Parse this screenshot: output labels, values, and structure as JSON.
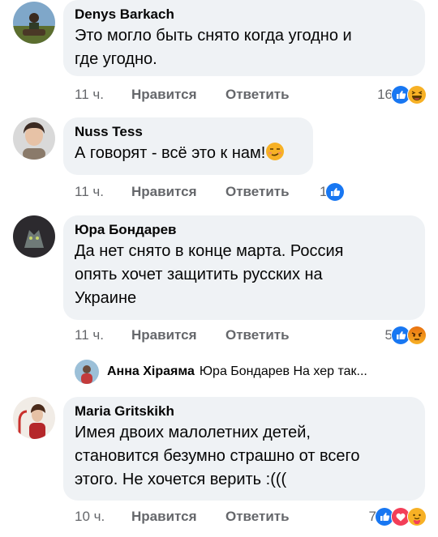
{
  "comments": [
    {
      "author": "Denys Barkach",
      "lines": [
        "Это могло быть снято когда угодно и",
        "где угодно."
      ],
      "time": "11 ч.",
      "like_label": "Нравится",
      "reply_label": "Ответить",
      "reaction_count": "16",
      "reactions": [
        "like-icon",
        "haha-icon"
      ]
    },
    {
      "author": "Nuss Tess",
      "lines": [
        "А говорят - всё это к нам!"
      ],
      "time": "11 ч.",
      "like_label": "Нравится",
      "reply_label": "Ответить",
      "reaction_count": "1",
      "reactions": [
        "like-icon"
      ]
    },
    {
      "author": "Юра Бондарев",
      "lines": [
        "Да нет снято в конце марта. Россия",
        "опять хочет защитить русских на",
        "Украине"
      ],
      "time": "11 ч.",
      "like_label": "Нравится",
      "reply_label": "Ответить",
      "reaction_count": "5",
      "reactions": [
        "like-icon",
        "angry-icon"
      ]
    },
    {
      "author": "Maria Gritskikh",
      "lines": [
        "Имея двоих малолетних детей,",
        "становится безумно страшно от всего",
        "этого. Не хочется верить :((("
      ],
      "time": "10 ч.",
      "like_label": "Нравится",
      "reply_label": "Ответить",
      "reaction_count": "7",
      "reactions": [
        "like-icon",
        "love-icon",
        "care-icon"
      ]
    }
  ],
  "reply_preview": {
    "author": "Анна Хіраяма",
    "text": "Юра Бондарев На хер так..."
  },
  "colors": {
    "bubble": "#eff2f5",
    "meta_text": "#65676b",
    "like_blue": "#1877f2",
    "love_red": "#f33e58",
    "emoji_yellow": "#f7b125"
  }
}
